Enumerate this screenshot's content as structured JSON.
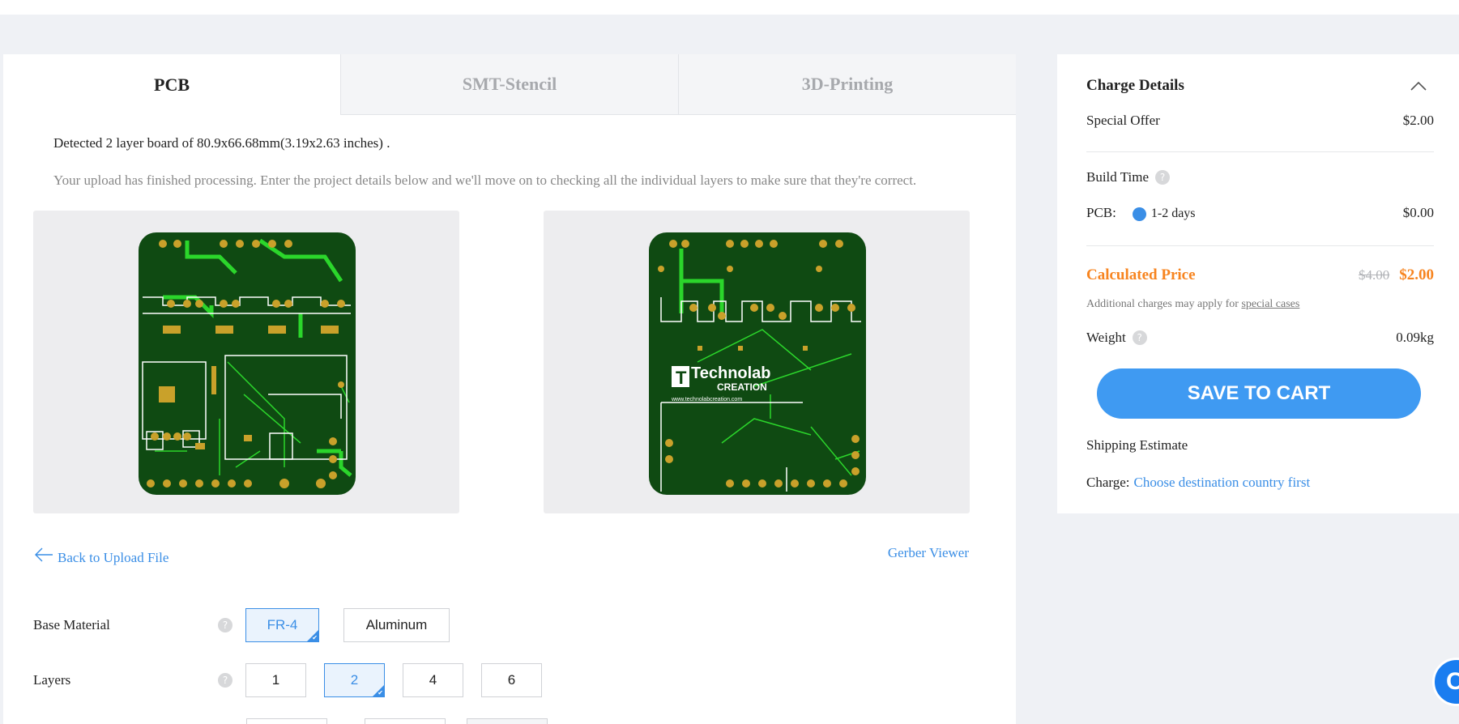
{
  "tabs": [
    "PCB",
    "SMT-Stencil",
    "3D-Printing"
  ],
  "detected_text": "Detected 2 layer board of 80.9x66.68mm(3.19x2.63 inches) .",
  "info_text": "Your upload has finished processing. Enter the project details below and we'll move on to checking all the individual layers to make sure that they're correct.",
  "board_logo": {
    "brand": "Technolab",
    "sub": "CREATION",
    "url": "www.technolabcreation.com"
  },
  "links": {
    "back": "Back to Upload File",
    "gerber": "Gerber Viewer"
  },
  "options": {
    "base_material": {
      "label": "Base Material",
      "choices": [
        "FR-4",
        "Aluminum"
      ],
      "selected": "FR-4"
    },
    "layers": {
      "label": "Layers",
      "choices": [
        "1",
        "2",
        "4",
        "6"
      ],
      "selected": "2"
    }
  },
  "charge": {
    "title": "Charge Details",
    "special_offer_label": "Special Offer",
    "special_offer_value": "$2.00",
    "build_time_label": "Build Time",
    "pcb_label": "PCB:",
    "pcb_option": "1-2 days",
    "pcb_value": "$0.00",
    "calc_label": "Calculated Price",
    "old_price": "$4.00",
    "new_price": "$2.00",
    "note_prefix": "Additional charges may apply for ",
    "note_link": "special cases",
    "weight_label": "Weight",
    "weight_value": "0.09kg",
    "cart_button": "SAVE TO CART",
    "shipping_label": "Shipping Estimate",
    "charge_label": "Charge:",
    "charge_link": "Choose destination country first"
  },
  "colors": {
    "accent": "#3a8ee6",
    "orange": "#f7841f",
    "pcb_green": "#0f4a12"
  },
  "icons": [
    "help-icon",
    "chevron-up-icon",
    "arrow-left-icon",
    "checkmark-icon",
    "chat-icon"
  ]
}
